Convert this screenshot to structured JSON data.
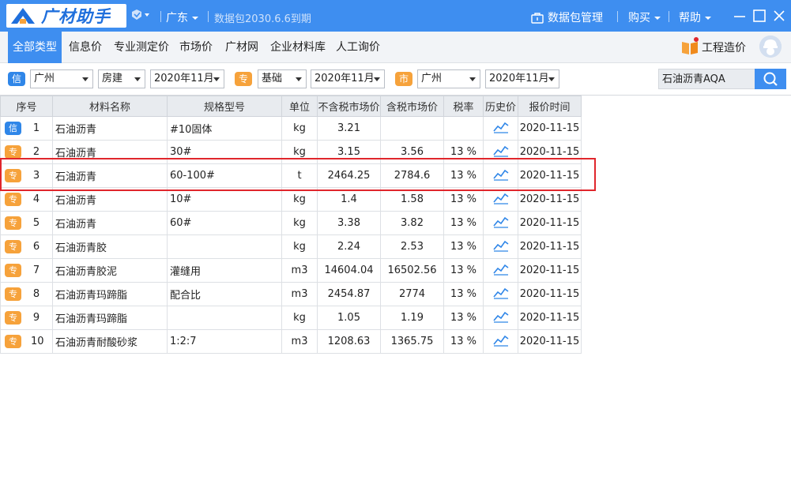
{
  "titlebar": {
    "logo_text": "广材助手",
    "region": "广东",
    "expire_text": "数据包2030.6.6到期",
    "data_pkg_label": "数据包管理",
    "buy_label": "购买",
    "help_label": "帮助"
  },
  "nav": {
    "items": [
      "全部类型",
      "信息价",
      "专业测定价",
      "市场价",
      "广材网",
      "企业材料库",
      "人工询价"
    ],
    "active_index": 0,
    "cost_label": "工程造价​"
  },
  "filters": {
    "info_badge": "信",
    "info_city": "广州",
    "info_category": "房建",
    "info_period": "2020年11月",
    "pro_badge": "专",
    "pro_category": "基础",
    "pro_period": "2020年11月",
    "market_badge": "市",
    "market_city": "广州",
    "market_period": "2020年11月",
    "search_value": "石油沥青AQA"
  },
  "table": {
    "headers": [
      "序号",
      "材料名称",
      "规格型号",
      "单位",
      "不含税市场价",
      "含税市场价",
      "税率",
      "历史价",
      "报价时间"
    ],
    "rows": [
      {
        "tag": "信",
        "tag_color": "blue",
        "seq": "1",
        "name": "石油沥青",
        "spec": "#10固体",
        "unit": "kg",
        "price_ex": "3.21",
        "price_in": "",
        "tax": "",
        "date": "2020-11-15"
      },
      {
        "tag": "专",
        "tag_color": "orange",
        "seq": "2",
        "name": "石油沥青",
        "spec": "30#",
        "unit": "kg",
        "price_ex": "3.15",
        "price_in": "3.56",
        "tax": "13 %",
        "date": "2020-11-15"
      },
      {
        "tag": "专",
        "tag_color": "orange",
        "seq": "3",
        "name": "石油沥青",
        "spec": "60-100#",
        "unit": "t",
        "price_ex": "2464.25",
        "price_in": "2784.6",
        "tax": "13 %",
        "date": "2020-11-15"
      },
      {
        "tag": "专",
        "tag_color": "orange",
        "seq": "4",
        "name": "石油沥青",
        "spec": "10#",
        "unit": "kg",
        "price_ex": "1.4",
        "price_in": "1.58",
        "tax": "13 %",
        "date": "2020-11-15"
      },
      {
        "tag": "专",
        "tag_color": "orange",
        "seq": "5",
        "name": "石油沥青",
        "spec": "60#",
        "unit": "kg",
        "price_ex": "3.38",
        "price_in": "3.82",
        "tax": "13 %",
        "date": "2020-11-15"
      },
      {
        "tag": "专",
        "tag_color": "orange",
        "seq": "6",
        "name": "石油沥青胶",
        "spec": "",
        "unit": "kg",
        "price_ex": "2.24",
        "price_in": "2.53",
        "tax": "13 %",
        "date": "2020-11-15"
      },
      {
        "tag": "专",
        "tag_color": "orange",
        "seq": "7",
        "name": "石油沥青胶泥",
        "spec": "灌缝用",
        "unit": "m3",
        "price_ex": "14604.04",
        "price_in": "16502.56",
        "tax": "13 %",
        "date": "2020-11-15"
      },
      {
        "tag": "专",
        "tag_color": "orange",
        "seq": "8",
        "name": "石油沥青玛蹄脂",
        "spec": "配合比",
        "unit": "m3",
        "price_ex": "2454.87",
        "price_in": "2774",
        "tax": "13 %",
        "date": "2020-11-15"
      },
      {
        "tag": "专",
        "tag_color": "orange",
        "seq": "9",
        "name": "石油沥青玛蹄脂",
        "spec": "",
        "unit": "kg",
        "price_ex": "1.05",
        "price_in": "1.19",
        "tax": "13 %",
        "date": "2020-11-15"
      },
      {
        "tag": "专",
        "tag_color": "orange",
        "seq": "10",
        "name": "石油沥青耐酸砂浆",
        "spec": "1:2:7",
        "unit": "m3",
        "price_ex": "1208.63",
        "price_in": "1365.75",
        "tax": "13 %",
        "date": "2020-11-15"
      }
    ],
    "highlighted_row": 3
  },
  "colors": {
    "brand_blue": "#3e8ef0",
    "tag_blue": "#2f86e8",
    "tag_orange": "#f6a23b",
    "highlight_red": "#e0262c"
  },
  "icons": {
    "history": "trend-chart-icon",
    "search": "search-icon",
    "package": "briefcase-icon"
  }
}
